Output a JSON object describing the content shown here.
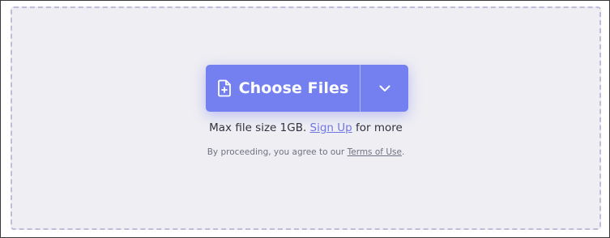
{
  "upload": {
    "choose_label": "Choose Files",
    "file_icon": "file-plus-icon",
    "dropdown_icon": "chevron-down-icon",
    "max_text": "Max file size 1GB.",
    "signup_link": "Sign Up",
    "more_text": "for more",
    "terms_prefix": "By proceeding, you agree to our",
    "terms_link": "Terms of Use",
    "terms_suffix": "."
  },
  "colors": {
    "accent": "#7480f0",
    "dropzone_bg": "#efeef3",
    "dashed_border": "#c3bcd9",
    "link": "#6f77e6"
  }
}
